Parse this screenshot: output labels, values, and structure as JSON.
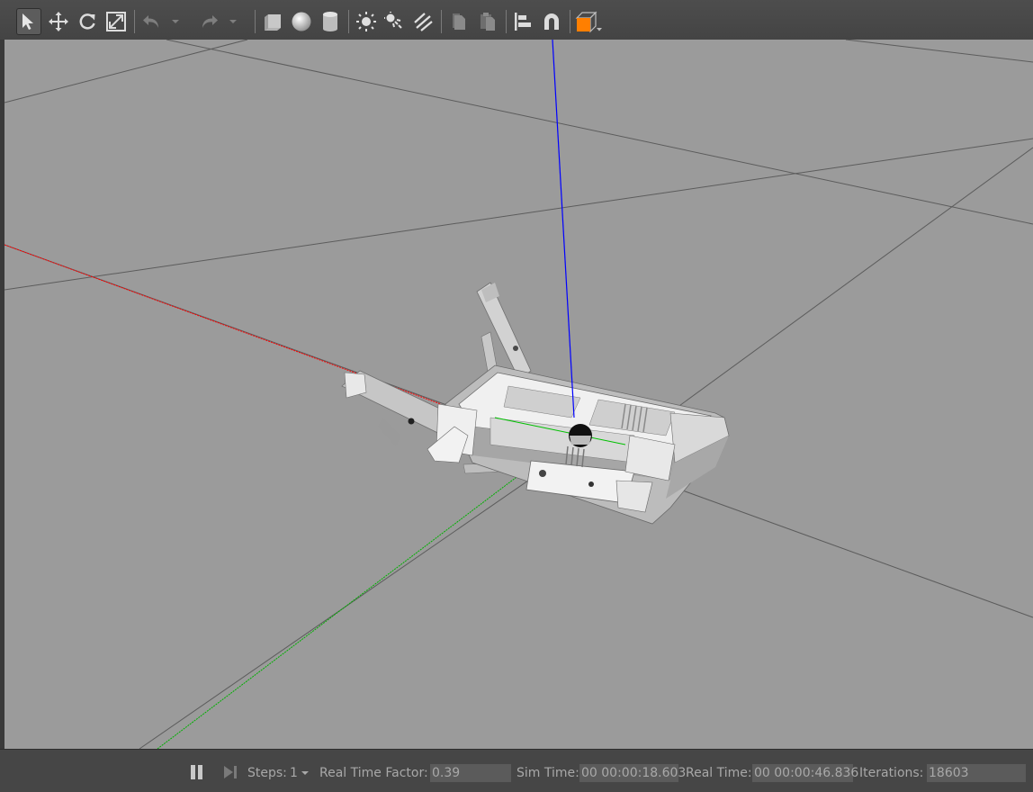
{
  "toolbar": {
    "tools": [
      {
        "name": "select-mode-icon",
        "active": true
      },
      {
        "name": "translate-mode-icon"
      },
      {
        "name": "rotate-mode-icon"
      },
      {
        "name": "scale-mode-icon"
      },
      {
        "name": "undo-icon"
      },
      {
        "name": "undo-dropdown-icon"
      },
      {
        "name": "redo-icon"
      },
      {
        "name": "redo-dropdown-icon"
      },
      {
        "name": "box-shape-icon"
      },
      {
        "name": "sphere-shape-icon"
      },
      {
        "name": "cylinder-shape-icon"
      },
      {
        "name": "point-light-icon"
      },
      {
        "name": "spot-light-icon"
      },
      {
        "name": "directional-light-icon"
      },
      {
        "name": "copy-icon"
      },
      {
        "name": "paste-icon"
      },
      {
        "name": "align-icon"
      },
      {
        "name": "snap-icon"
      },
      {
        "name": "view-angle-icon"
      }
    ],
    "accent_color": "#ff7f00"
  },
  "viewport": {
    "background": "#9b9b9b",
    "axis_colors": {
      "x": "#ff0000",
      "y": "#00b000",
      "z": "#0000ff"
    }
  },
  "statusbar": {
    "steps_label": "Steps:",
    "steps_value": "1",
    "rtf_label": "Real Time Factor:",
    "rtf_value": "0.39",
    "sim_time_label": "Sim Time:",
    "sim_time_value": "00 00:00:18.603",
    "real_time_label": "Real Time:",
    "real_time_value": "00 00:00:46.836",
    "iterations_label": "Iterations:",
    "iterations_value": "18603"
  }
}
